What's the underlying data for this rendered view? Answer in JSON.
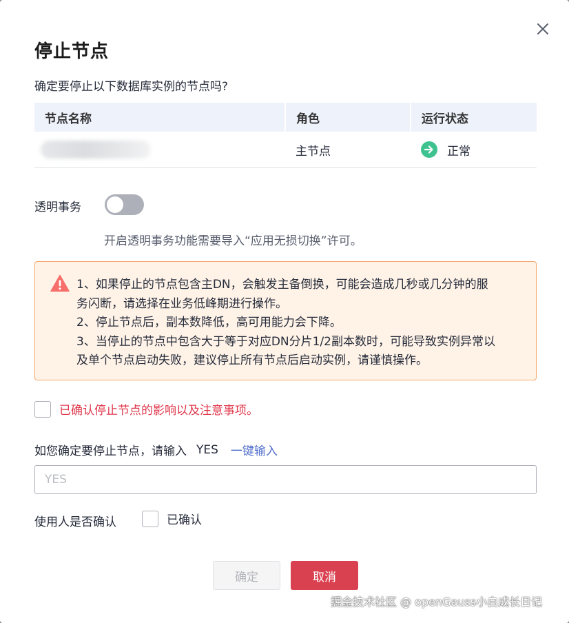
{
  "dialog": {
    "title": "停止节点",
    "question": "确定要停止以下数据库实例的节点吗?"
  },
  "table": {
    "headers": [
      "节点名称",
      "角色",
      "运行状态"
    ],
    "rows": [
      {
        "name": "",
        "role": "主节点",
        "status": "正常"
      }
    ],
    "status_color": "#3ec28f"
  },
  "transparent_tx": {
    "label": "透明事务",
    "enabled": false,
    "hint": "开启透明事务功能需要导入“应用无损切换”许可。"
  },
  "alert": {
    "lines": [
      "1、如果停止的节点包含主DN，会触发主备倒换，可能会造成几秒或几分钟的服",
      "务闪断，请选择在业务低峰期进行操作。",
      "2、停止节点后，副本数降低，高可用能力会下降。",
      "3、当停止的节点中包含大于等于对应DN分片1/2副本数时，可能导致实例异常以",
      "及单个节点启动失败，建议停止所有节点后启动实例，请谨慎操作。"
    ],
    "accent_color": "#f66f6a"
  },
  "ack": {
    "label": "已确认停止节点的影响以及注意事项。",
    "checked": false
  },
  "confirm": {
    "prompt": "如您确定要停止节点，请输入",
    "keyword": "YES",
    "one_click_label": "一键输入",
    "input_value": "",
    "input_placeholder": "YES"
  },
  "user_confirm": {
    "label": "使用人是否确认",
    "checkbox_label": "已确认",
    "checked": false
  },
  "buttons": {
    "ok_label": "确定",
    "cancel_label": "取消"
  },
  "watermark": "掘金技术社区 @ openGauss小白成长日记"
}
